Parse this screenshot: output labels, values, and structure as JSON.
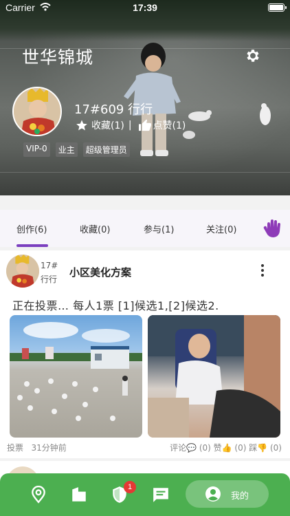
{
  "status_bar": {
    "carrier": "Carrier",
    "time": "17:39"
  },
  "header": {
    "community_name": "世华锦城"
  },
  "profile": {
    "title": "17#609 行行",
    "favorites": "收藏(1)",
    "likes": "点赞(1)",
    "badges": [
      "VIP-0",
      "业主",
      "超级管理员"
    ]
  },
  "tabs": [
    {
      "label": "创作(6)",
      "active": true
    },
    {
      "label": "收藏(0)",
      "active": false
    },
    {
      "label": "参与(1)",
      "active": false
    },
    {
      "label": "关注(0)",
      "active": false
    }
  ],
  "post": {
    "author_unit": "17#",
    "author_name": "行行",
    "title": "小区美化方案",
    "content": "正在投票…  每人1票  [1]候选1,[2]候选2.",
    "type": "投票",
    "time": "31分钟前",
    "stats": "评论💬 (0)  赞👍 (0)  踩👎 (0)"
  },
  "bottom_nav": {
    "items": [
      "location-icon",
      "building-icon",
      "shield-icon",
      "message-icon"
    ],
    "shield_badge": "1",
    "mine_label": "我的"
  },
  "colors": {
    "accent": "#7b3fbf",
    "nav_green": "#4caf50",
    "badge_red": "#e53935"
  }
}
